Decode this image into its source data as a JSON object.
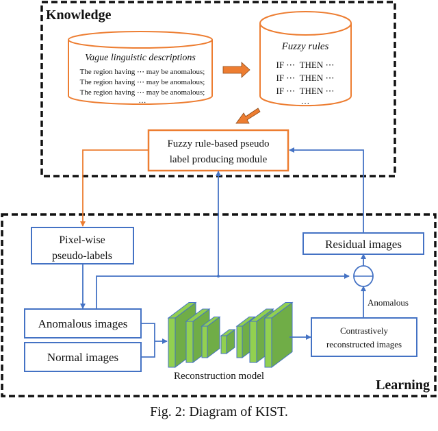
{
  "regions": {
    "knowledge": {
      "title": "Knowledge"
    },
    "learning": {
      "title": "Learning"
    }
  },
  "knowledge": {
    "vague_db": {
      "title": "Vague linguistic descriptions",
      "lines": [
        "The region having ⋯ may be anomalous;",
        "The region having ⋯ may be anomalous;",
        "The region having ⋯ may be anomalous;"
      ],
      "ellipsis": "…"
    },
    "fuzzy_db": {
      "title": "Fuzzy rules",
      "lines": [
        "IF ⋯  THEN ⋯",
        "IF ⋯  THEN ⋯",
        "IF ⋯  THEN ⋯"
      ],
      "ellipsis": "…"
    },
    "module": {
      "line1": "Fuzzy rule-based pseudo",
      "line2": "label producing module"
    }
  },
  "learning": {
    "pseudo_labels": {
      "line1": "Pixel-wise",
      "line2": "pseudo-labels"
    },
    "anomalous_images": "Anomalous images",
    "normal_images": "Normal images",
    "reconstruction_model": "Reconstruction model",
    "contrastive": {
      "line1": "Contrastively",
      "line2": "reconstructed images"
    },
    "residual_images": "Residual images",
    "anomalous_edge_label": "Anomalous",
    "subtract_symbol": "minus-circle"
  },
  "caption": "Fig. 2: Diagram of KIST.",
  "colors": {
    "orange": "#ED7D31",
    "blue": "#4472C4",
    "green_front": "#92D050",
    "green_side": "#70AD47",
    "dash": "#111111"
  }
}
